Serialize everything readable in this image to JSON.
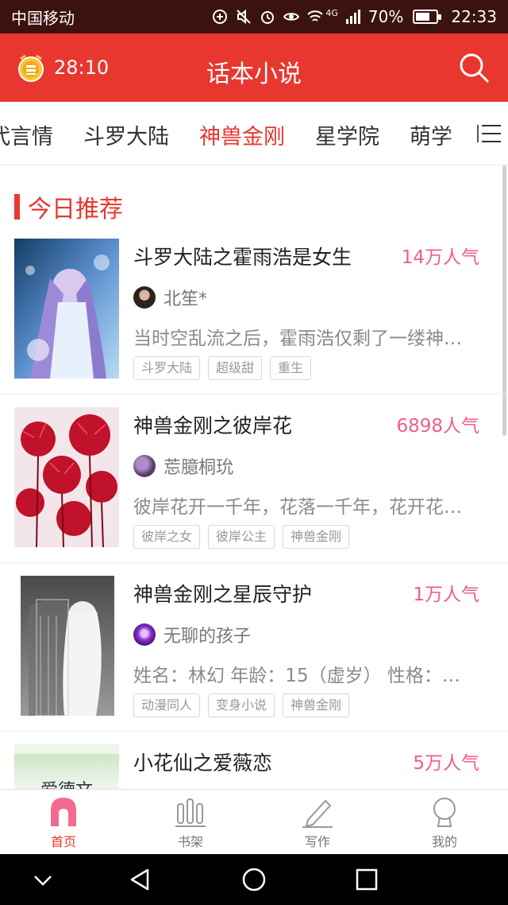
{
  "status_bar": {
    "carrier": "中国移动",
    "network": "4G",
    "battery": "70%",
    "battery_level": 0.7,
    "time": "22:33"
  },
  "header": {
    "timer": "28:10",
    "title": "话本小说",
    "accent_color": "#e8372f"
  },
  "tabs": [
    {
      "label": "代言情"
    },
    {
      "label": "斗罗大陆"
    },
    {
      "label": "神兽金刚",
      "active": true
    },
    {
      "label": "星学院"
    },
    {
      "label": "萌学"
    }
  ],
  "section": {
    "title": "今日推荐"
  },
  "books": [
    {
      "title": "斗罗大陆之霍雨浩是女生",
      "popularity": "14万人气",
      "author": "北笙*",
      "description": "当时空乱流之后，霍雨浩仅剩了一缕神…",
      "tags": [
        "斗罗大陆",
        "超级甜",
        "重生"
      ]
    },
    {
      "title": "神兽金刚之彼岸花",
      "popularity": "6898人气",
      "author": "莣臆桐玧",
      "description": "彼岸花开一千年，花落一千年，花开花…",
      "tags": [
        "彼岸之女",
        "彼岸公主",
        "神兽金刚"
      ]
    },
    {
      "title": "神兽金刚之星辰守护",
      "popularity": "1万人气",
      "author": "无聊的孩子",
      "description": "姓名：林幻 年龄：15（虚岁） 性格：…",
      "tags": [
        "动漫同人",
        "变身小说",
        "神兽金刚"
      ]
    },
    {
      "title": "小花仙之爱薇恋",
      "popularity": "5万人气",
      "cover_text": "爱德文"
    }
  ],
  "bottom_nav": [
    {
      "label": "首页",
      "icon": "home-icon",
      "active": true
    },
    {
      "label": "书架",
      "icon": "bookshelf-icon"
    },
    {
      "label": "写作",
      "icon": "pen-icon"
    },
    {
      "label": "我的",
      "icon": "profile-icon"
    }
  ]
}
